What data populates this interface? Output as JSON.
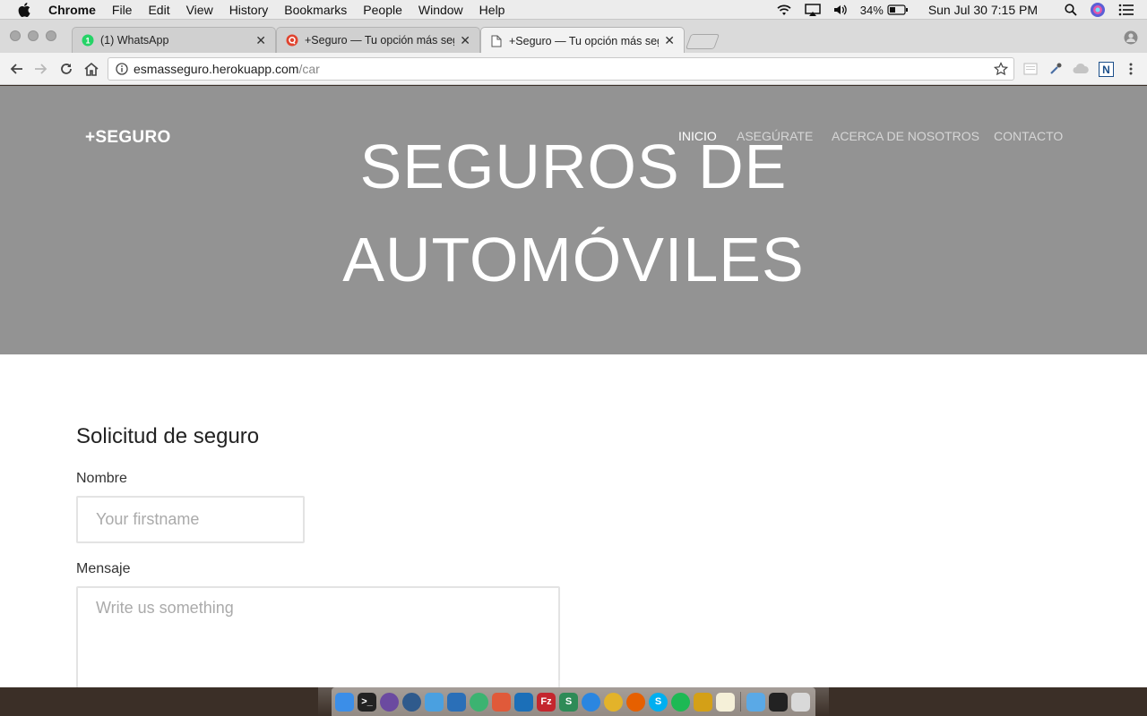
{
  "menubar": {
    "app": "Chrome",
    "items": [
      "File",
      "Edit",
      "View",
      "History",
      "Bookmarks",
      "People",
      "Window",
      "Help"
    ],
    "battery": "34%",
    "clock": "Sun Jul 30  7:15 PM"
  },
  "tabs": [
    {
      "title": "(1) WhatsApp",
      "icon": "whatsapp-icon"
    },
    {
      "title": "+Seguro — Tu opción más seg",
      "icon": "quora-icon"
    },
    {
      "title": "+Seguro — Tu opción más seg",
      "icon": "page-icon"
    }
  ],
  "address": {
    "host": "esmasseguro.herokuapp.com",
    "path": "/car"
  },
  "site": {
    "brand": "+SEGURO",
    "nav": [
      "INICIO",
      "ASEGÚRATE",
      "ACERCA DE NOSOTROS",
      "CONTACTO"
    ],
    "hero_line1": "SEGUROS DE",
    "hero_line2": "AUTOMÓVILES"
  },
  "form": {
    "title": "Solicitud de seguro",
    "name_label": "Nombre",
    "name_placeholder": "Your firstname",
    "message_label": "Mensaje",
    "message_placeholder": "Write us something"
  },
  "colors": {
    "hero_bg": "#939393",
    "page_bg": "#ffffff",
    "input_border": "#e3e3e3"
  }
}
